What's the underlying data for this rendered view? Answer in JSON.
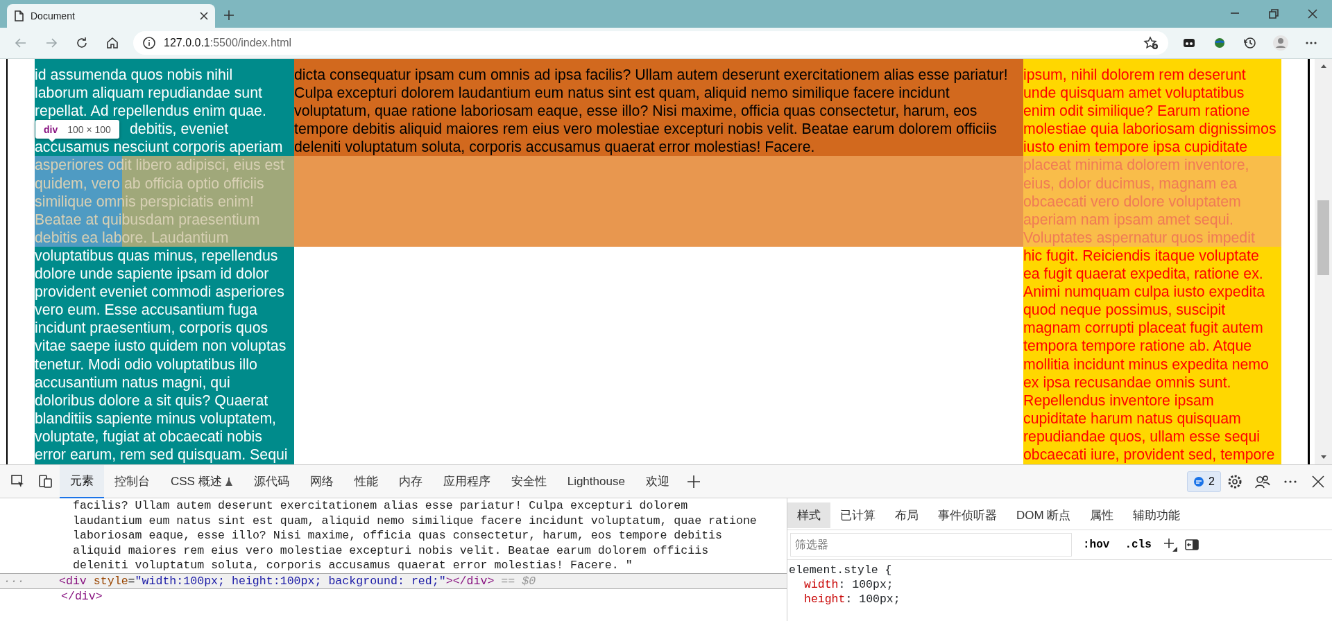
{
  "browser": {
    "tab": {
      "title": "Document",
      "selected": true
    },
    "nav": [
      {
        "kind": "back",
        "disabled": true
      },
      {
        "kind": "forward",
        "disabled": true
      },
      {
        "kind": "reload",
        "disabled": false
      },
      {
        "kind": "home",
        "disabled": false
      }
    ],
    "url": {
      "host": "127.0.0.1",
      "rest": ":5500/index.html"
    }
  },
  "page": {
    "highlight": {
      "tag": "div",
      "size": "100 × 100"
    },
    "columns": [
      {
        "kind": "left",
        "color": "#008b8b",
        "lines": [
          {
            "text": "id assumenda quos nobis nihil",
            "highlighted": false
          },
          {
            "text": "laborum aliquam repudiandae sunt",
            "highlighted": false
          },
          {
            "text": "repellat. Ad repellendus enim quae.",
            "highlighted": false
          },
          {
            "text": "debitis, eveniet",
            "highlighted": false,
            "covered": true
          },
          {
            "text": "accusamus nesciunt corporis aperiam",
            "highlighted": false
          },
          {
            "text": "asperiores odit libero adipisci, eius est",
            "highlighted": true
          },
          {
            "text": "quidem, vero ab officia optio officiis",
            "highlighted": true
          },
          {
            "text": "similique omnis perspiciatis enim!",
            "highlighted": true
          },
          {
            "text": "Beatae at quibusdam praesentium",
            "highlighted": true
          },
          {
            "text": "debitis ea labore. Laudantium",
            "highlighted": true
          },
          {
            "text": "voluptatibus quas minus, repellendus",
            "highlighted": false
          },
          {
            "text": "dolore unde sapiente ipsam id dolor",
            "highlighted": false
          },
          {
            "text": "provident eveniet commodi asperiores",
            "highlighted": false
          },
          {
            "text": "vero eum. Esse accusantium fuga",
            "highlighted": false
          },
          {
            "text": "incidunt praesentium, corporis quos",
            "highlighted": false
          },
          {
            "text": "vitae saepe iusto quidem non voluptas",
            "highlighted": false
          },
          {
            "text": "tenetur. Modi odio voluptatibus illo",
            "highlighted": false
          },
          {
            "text": "accusantium natus magni, qui",
            "highlighted": false
          },
          {
            "text": "doloribus dolore a sit quis? Quaerat",
            "highlighted": false
          },
          {
            "text": "blanditiis sapiente minus voluptatem,",
            "highlighted": false
          },
          {
            "text": "voluptate, fugiat at obcaecati nobis",
            "highlighted": false
          },
          {
            "text": "error earum, rem sed quisquam. Sequi",
            "highlighted": false
          }
        ]
      },
      {
        "kind": "middle",
        "color": "#d2691e",
        "lines": [
          {
            "text": "dicta consequatur ipsam cum omnis ad ipsa facilis? Ullam autem deserunt exercitationem alias esse pariatur!",
            "highlighted": false
          },
          {
            "text": "Culpa excepturi dolorem laudantium eum natus sint est quam, aliquid nemo similique facere incidunt",
            "highlighted": false
          },
          {
            "text": "voluptatum, quae ratione laboriosam eaque, esse illo? Nisi maxime, officia quas consectetur, harum, eos",
            "highlighted": false
          },
          {
            "text": "tempore debitis aliquid maiores rem eius vero molestiae excepturi nobis velit. Beatae earum dolorem officiis",
            "highlighted": false
          },
          {
            "text": "deleniti voluptatum soluta, corporis accusamus quaerat error molestias! Facere.",
            "highlighted": false
          }
        ]
      },
      {
        "kind": "right",
        "color": "#ffd700",
        "lines": [
          {
            "text": "ipsum, nihil dolorem rem deserunt",
            "highlighted": false
          },
          {
            "text": "unde quisquam amet voluptatibus",
            "highlighted": false
          },
          {
            "text": "enim odit similique? Earum ratione",
            "highlighted": false
          },
          {
            "text": "molestiae quia laboriosam dignissimos",
            "highlighted": false
          },
          {
            "text": "iusto enim tempore ipsa cupiditate",
            "highlighted": false
          },
          {
            "text": "placeat minima dolorem inventore,",
            "highlighted": true
          },
          {
            "text": "eius, dolor ducimus, magnam ea",
            "highlighted": true
          },
          {
            "text": "obcaecati vero dolore voluptatem",
            "highlighted": true
          },
          {
            "text": "aperiam nam ipsam amet sequi.",
            "highlighted": true
          },
          {
            "text": "Voluptates aspernatur quos impedit",
            "highlighted": true
          },
          {
            "text": "hic fugit. Reiciendis itaque voluptate",
            "highlighted": false
          },
          {
            "text": "ea fugit quaerat expedita, ratione ex.",
            "highlighted": false
          },
          {
            "text": "Animi numquam culpa iusto expedita",
            "highlighted": false
          },
          {
            "text": "quod neque possimus, suscipit",
            "highlighted": false
          },
          {
            "text": "magnam corrupti placeat fugit autem",
            "highlighted": false
          },
          {
            "text": "tempora tempore ratione ab. Atque",
            "highlighted": false
          },
          {
            "text": "mollitia incidunt minus expedita nemo",
            "highlighted": false
          },
          {
            "text": "ex ipsa recusandae omnis sunt.",
            "highlighted": false
          },
          {
            "text": "Repellendus inventore ipsam",
            "highlighted": false
          },
          {
            "text": "cupiditate harum natus quisquam",
            "highlighted": false
          },
          {
            "text": "repudiandae quos, ullam esse sequi",
            "highlighted": false
          },
          {
            "text": "obcaecati iure, provident sed, tempore",
            "highlighted": false
          }
        ]
      }
    ]
  },
  "devtools": {
    "tabs": [
      {
        "label": "元素",
        "selected": true
      },
      {
        "label": "控制台",
        "selected": false
      },
      {
        "label": "CSS 概述",
        "selected": false,
        "kind": "flask"
      },
      {
        "label": "源代码",
        "selected": false
      },
      {
        "label": "网络",
        "selected": false
      },
      {
        "label": "性能",
        "selected": false
      },
      {
        "label": "内存",
        "selected": false
      },
      {
        "label": "应用程序",
        "selected": false
      },
      {
        "label": "安全性",
        "selected": false
      },
      {
        "label": "Lighthouse",
        "selected": false
      },
      {
        "label": "欢迎",
        "selected": false
      }
    ],
    "issues_count": "2",
    "dom_text": [
      "facilis? Ullam autem deserunt exercitationem alias esse pariatur! Culpa excepturi dolorem",
      "laudantium eum natus sint est quam, aliquid nemo similique facere incidunt voluptatum, quae ratione",
      "laboriosam eaque, esse illo? Nisi maxime, officia quas consectetur, harum, eos tempore debitis",
      "aliquid maiores rem eius vero molestiae excepturi nobis velit. Beatae earum dolorem officiis",
      "deleniti voluptatum soluta, corporis accusamus quaerat error molestias! Facere. \""
    ],
    "selected_node": {
      "open": "<div",
      "attr": "style",
      "equals": "=",
      "value": "\"width:100px; height:100px; background: red;\"",
      "close": "></div>",
      "marker": "== $0",
      "ellipsis": "···"
    },
    "closing_tag": "</div>",
    "styles": {
      "tabs": [
        {
          "label": "样式",
          "selected": true
        },
        {
          "label": "已计算",
          "selected": false
        },
        {
          "label": "布局",
          "selected": false
        },
        {
          "label": "事件侦听器",
          "selected": false
        },
        {
          "label": "DOM 断点",
          "selected": false
        },
        {
          "label": "属性",
          "selected": false
        },
        {
          "label": "辅助功能",
          "selected": false
        }
      ],
      "filter_placeholder": "筛选器",
      "buttons": [
        ":hov",
        ".cls"
      ],
      "selector": "element.style {",
      "declarations": [
        {
          "property": "width",
          "value": ": 100px;"
        },
        {
          "property": "height",
          "value": ": 100px;"
        }
      ]
    }
  }
}
